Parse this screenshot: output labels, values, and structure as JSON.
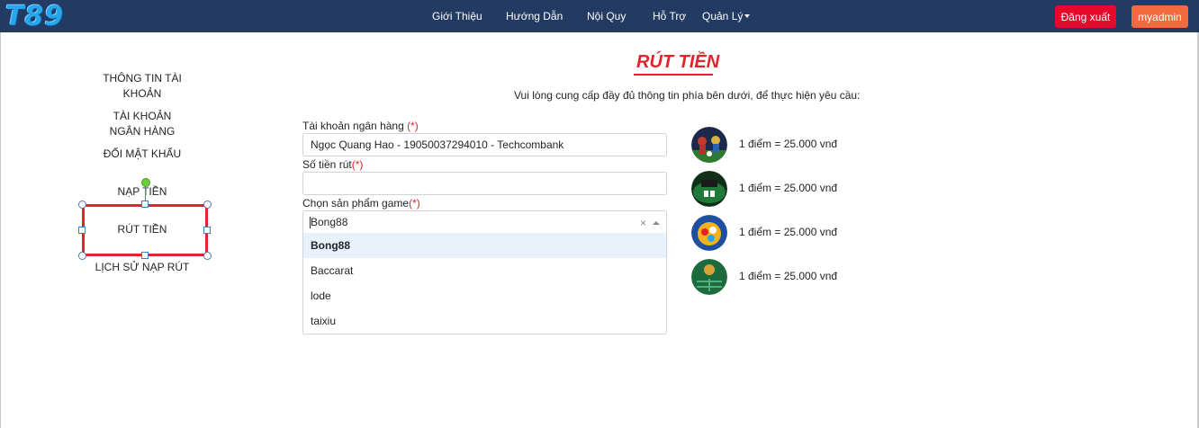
{
  "navbar": {
    "logo": "T89",
    "links": [
      "Giới Thiệu",
      "Hướng Dẫn",
      "Nội Quy",
      "Hỗ Trợ",
      "Quản Lý"
    ],
    "logout_label": "Đăng xuất",
    "user_label": "myadmin",
    "colors": {
      "bar": "#233a63",
      "logout": "#e5092b",
      "user": "#f36a3e"
    }
  },
  "sidebar": {
    "items": [
      "THÔNG TIN TÀI KHOẢN",
      "TÀI KHOẢN NGÂN HÀNG",
      "ĐỔI MẬT KHẨU",
      "NẠP TIỀN",
      "RÚT TIỀN",
      "LỊCH SỬ NẠP RÚT"
    ],
    "selected": "RÚT TIỀN"
  },
  "main": {
    "title": "RÚT TIỀN",
    "subtitle": "Vui lòng cung cấp đầy đủ thông tin phía bên dưới, để thực hiện yêu cầu:",
    "bank_label": "Tài khoản ngân hàng",
    "bank_value": "Ngọc Quang Hao - 19050037294010 - Techcombank",
    "amount_label": "Số tiền rút",
    "amount_value": "",
    "game_label": "Chọn sản phẩm game",
    "required_mark": "(*)",
    "game_value": "Bong88",
    "game_clear": "×",
    "game_options": [
      "Bong88",
      "Baccarat",
      "lode",
      "taixiu"
    ]
  },
  "rates": [
    {
      "icon": "football-game-icon",
      "text": "1 điểm = 25.000 vnđ"
    },
    {
      "icon": "baccarat-table-icon",
      "text": "1 điểm = 25.000 vnđ"
    },
    {
      "icon": "lottery-balls-icon",
      "text": "1 điểm = 25.000 vnđ"
    },
    {
      "icon": "dice-table-icon",
      "text": "1 điểm = 25.000 vnđ"
    }
  ],
  "accent": "#e0232c"
}
